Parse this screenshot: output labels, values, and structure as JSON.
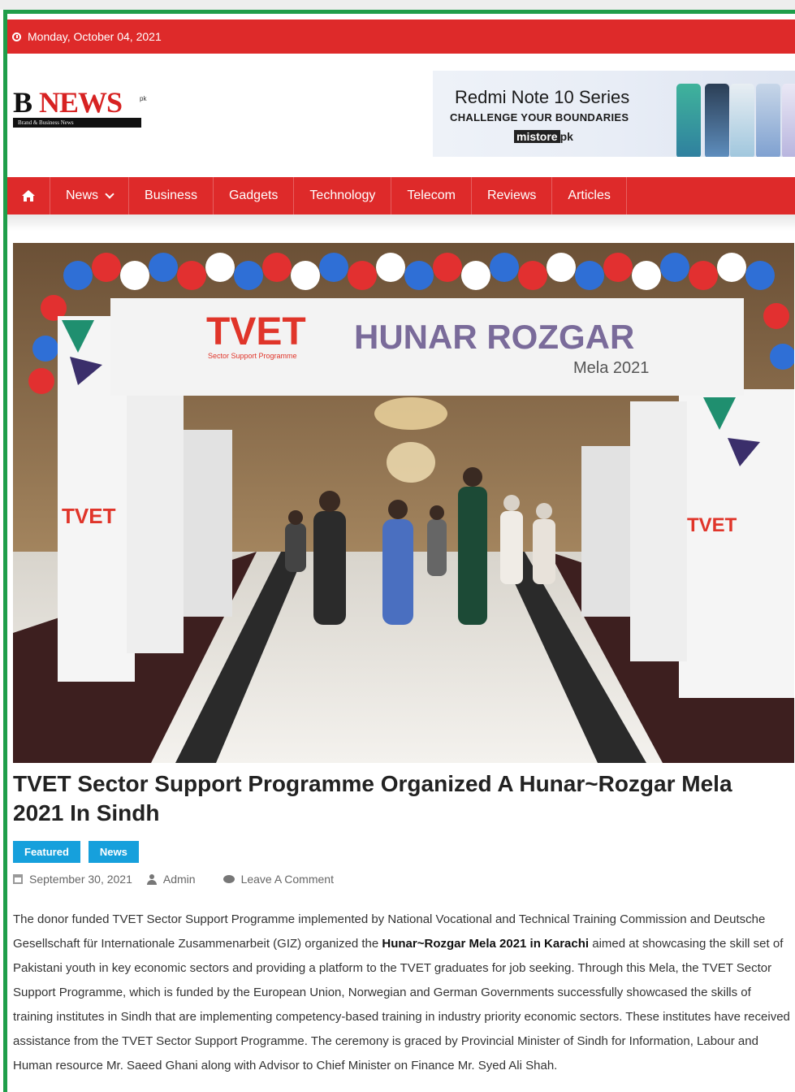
{
  "topbar": {
    "date": "Monday, October 04, 2021"
  },
  "logo": {
    "letter": "B",
    "word": "NEWS",
    "suffix": "pk",
    "tagline": "Brand & Business News"
  },
  "ad": {
    "headline": "Redmi Note 10 Series",
    "subline": "CHALLENGE YOUR BOUNDARIES",
    "store_mark": "mistore",
    "store_suffix": "pk"
  },
  "nav": {
    "items": [
      "News",
      "Business",
      "Gadgets",
      "Technology",
      "Telecom",
      "Reviews",
      "Articles"
    ]
  },
  "hero": {
    "banner_left": "TVET",
    "banner_left_sub": "Sector Support Programme",
    "banner_right": "HUNAR ROZGAR",
    "banner_right_sub": "Mela 2021"
  },
  "article": {
    "title": "TVET Sector Support Programme Organized A Hunar~Rozgar Mela 2021 In Sindh",
    "tags": [
      "Featured",
      "News"
    ],
    "date": "September 30, 2021",
    "author": "Admin",
    "comment": "Leave A Comment",
    "body_part1": "The donor funded TVET Sector Support Programme implemented by National Vocational and Technical Training Commission and Deutsche Gesellschaft für Internationale Zusammenarbeit (GIZ) organized the ",
    "body_bold": "Hunar~Rozgar Mela 2021 in Karachi",
    "body_part2": " aimed at showcasing the skill set of Pakistani youth in key economic sectors and providing a platform to the TVET graduates for job seeking. Through this Mela, the TVET Sector Support Programme, which is funded by the European Union, Norwegian and German Governments successfully showcased the skills of training institutes in Sindh that are implementing competency-based training in industry priority economic sectors. These institutes have received assistance from the TVET Sector Support Programme. The ceremony is graced by Provincial Minister of Sindh for Information, Labour and Human resource Mr. Saeed Ghani along with Advisor to Chief Minister on Finance Mr. Syed Ali Shah."
  },
  "colors": {
    "accent": "#de2a2a",
    "frame": "#1f9e4a",
    "tag": "#16a0dc"
  }
}
